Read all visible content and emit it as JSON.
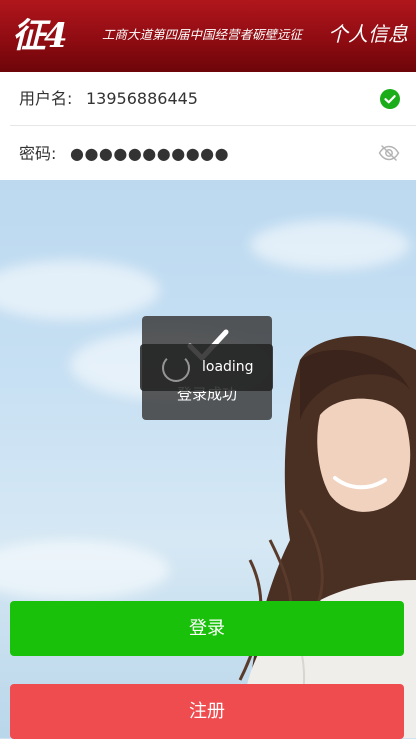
{
  "header": {
    "logo": "征4",
    "slogan": "工商大道第四届中国经营者砺壁远征",
    "title": "个人信息"
  },
  "form": {
    "username_label": "用户名:",
    "username_value": "13956886445",
    "password_label": "密码:",
    "password_value": "●●●●●●●●●●●"
  },
  "toast": {
    "success_text": "登录成功",
    "loading_text": "loading"
  },
  "buttons": {
    "login": "登录",
    "register": "注册"
  },
  "colors": {
    "header": "#9e1016",
    "login": "#1ac10a",
    "register": "#ef4c4f",
    "check": "#1aad19"
  },
  "icons": [
    "check-circle-icon",
    "eye-off-icon",
    "checkmark-icon",
    "spinner-icon"
  ]
}
